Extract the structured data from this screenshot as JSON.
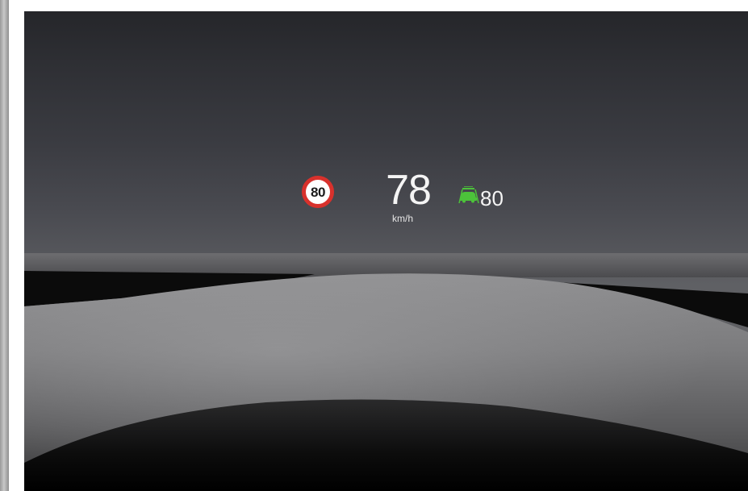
{
  "hud": {
    "speed_limit_sign": {
      "value": "80",
      "ring_color": "#d8312c"
    },
    "current_speed": {
      "value": "78",
      "unit": "km/h"
    },
    "cruise_control": {
      "icon": "adaptive-cruise-icon",
      "icon_color": "#4cc23a",
      "set_speed": "80"
    }
  }
}
